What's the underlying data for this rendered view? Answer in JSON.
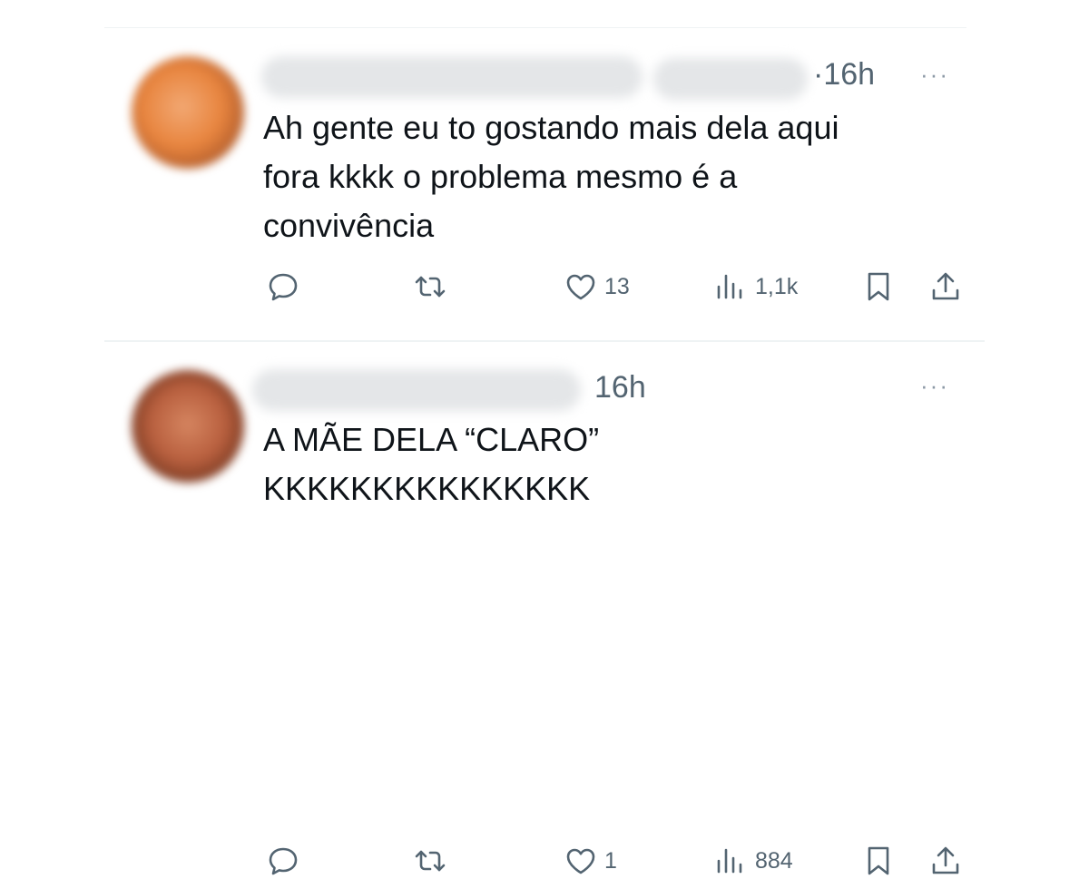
{
  "tweets": [
    {
      "time": "·16h",
      "more": "···",
      "text": "Ah gente eu to gostando mais dela aqui\nfora kkkk o problema mesmo é a\nconvivência",
      "likes": "13",
      "views": "1,1k"
    },
    {
      "time": "16h",
      "more": "···",
      "text": "A MÃE DELA “CLARO”\nKKKKKKKKKKKKKKK",
      "likes": "1",
      "views": "884"
    }
  ],
  "icons": [
    "reply-icon",
    "retweet-icon",
    "heart-icon",
    "views-icon",
    "bookmark-icon",
    "share-icon"
  ],
  "colors": {
    "text": "#0f1419",
    "secondary": "#536471",
    "divider": "#eff3f4"
  }
}
